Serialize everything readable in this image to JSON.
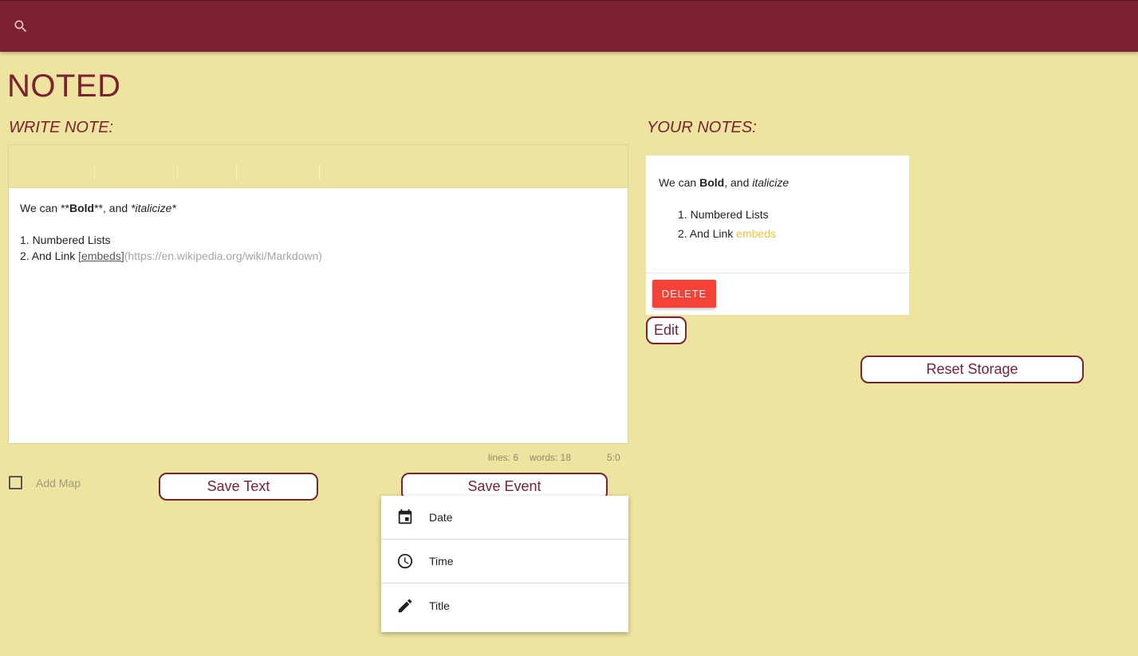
{
  "header": {
    "search_icon": "search-icon"
  },
  "app": {
    "title": "NOTED"
  },
  "write": {
    "heading": "WRITE NOTE:"
  },
  "editor": {
    "line1": {
      "a": "We can **",
      "b": "Bold",
      "c": "**, and ",
      "d": "*italicize*"
    },
    "line2": "",
    "line3": "1. Numbered Lists",
    "line4": {
      "a": "2. And Link ",
      "link": "[embeds]",
      "url": "(https://en.wikipedia.org/wiki/Markdown)"
    },
    "status": {
      "lines": "lines: 6",
      "words": "words: 18",
      "cursor": "5:0"
    }
  },
  "addmap": {
    "label": "Add Map",
    "checked": false
  },
  "buttons": {
    "save_text": "Save Text",
    "save_event": "Save Event",
    "edit": "Edit",
    "reset": "Reset Storage",
    "delete": "DELETE"
  },
  "event_menu": {
    "items": [
      {
        "icon": "calendar-icon",
        "label": "Date"
      },
      {
        "icon": "clock-icon",
        "label": "Time"
      },
      {
        "icon": "pencil-icon",
        "label": "Title"
      }
    ]
  },
  "notes": {
    "heading": "YOUR NOTES:",
    "card": {
      "p": {
        "a": "We can ",
        "b": "Bold",
        "c": ", and ",
        "d": "italicize"
      },
      "list": [
        "Numbered Lists",
        "And Link "
      ],
      "link": "embeds"
    }
  },
  "colors": {
    "background": "#ede49f",
    "brand": "#7b2130",
    "delete": "#f44336",
    "link": "#f4c430"
  }
}
